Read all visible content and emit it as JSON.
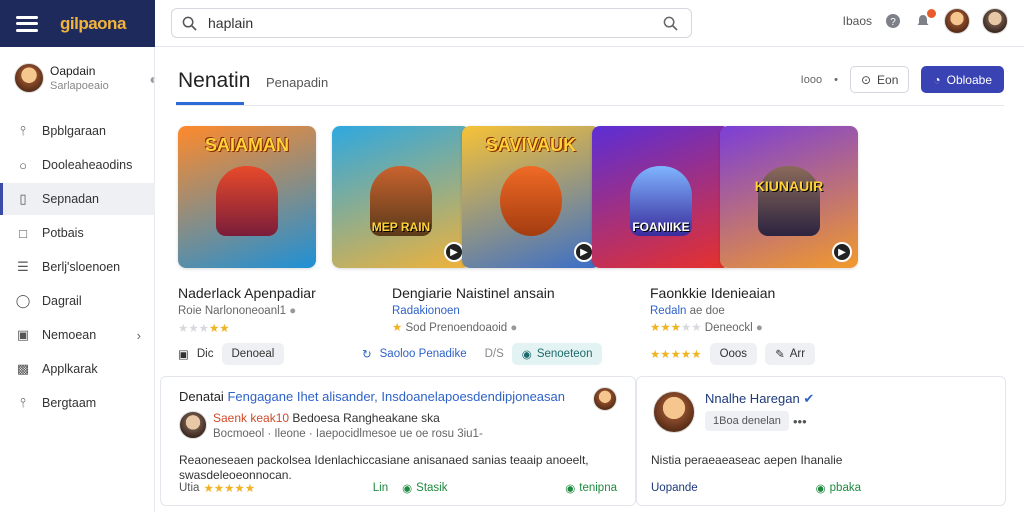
{
  "brand": {
    "logo": "gilpaona"
  },
  "search": {
    "value": "haplain"
  },
  "topbar": {
    "link": "Ibaos"
  },
  "profile": {
    "name": "Oapdain",
    "subtitle": "Sarlapoeaio"
  },
  "sidebar": {
    "items": [
      {
        "label": "Bpblgaraan",
        "icon": "pin-icon"
      },
      {
        "label": "Dooleaheaodins",
        "icon": "shield-icon"
      },
      {
        "label": "Sepnadan",
        "icon": "document-icon",
        "active": true
      },
      {
        "label": "Potbais",
        "icon": "image-icon"
      },
      {
        "label": "Berlj'sloenoen",
        "icon": "list-icon"
      },
      {
        "label": "Dagrail",
        "icon": "chat-icon"
      },
      {
        "label": "Nemoean",
        "icon": "grid-icon",
        "chevron": true
      },
      {
        "label": "Applkarak",
        "icon": "app-icon"
      },
      {
        "label": "Bergtaam",
        "icon": "person-icon"
      }
    ]
  },
  "main": {
    "title": "Nenatin",
    "tab2": "Penapadin",
    "header_small": "Iooo",
    "btn_outline": "Eon",
    "btn_primary": "Obloabe"
  },
  "tiles": [
    {
      "title": "SAIAMAN",
      "sub": "",
      "colors": [
        "#ff8a2b",
        "#1e90d6"
      ]
    },
    {
      "title": "",
      "sub": "MEP RAIN",
      "colors": [
        "#2ea8e0",
        "#f0b23a"
      ]
    },
    {
      "title": "SAVIVAUK",
      "sub": "",
      "colors": [
        "#f7c236",
        "#3a6ec8"
      ]
    },
    {
      "title": "",
      "sub": "FOANIIKE",
      "colors": [
        "#5b2ed6",
        "#e8312a"
      ]
    },
    {
      "title": "",
      "sub": "KIUNAUIR",
      "colors": [
        "#7b3ed8",
        "#f29a2b"
      ]
    }
  ],
  "cards": [
    {
      "title": "Naderlack Apenpadiar",
      "sub_plain": "Roie Narlononeoanl1",
      "sub_blue": "",
      "rating_text": "",
      "stars": 2,
      "action_label": "Dic",
      "pill": "Denoeal"
    },
    {
      "title": "Dengiarie Naistinel ansain",
      "sub_plain": "",
      "sub_blue": "Radakionoen",
      "rating_text": "Sod Prenoendoaoid",
      "stars": 1,
      "action_label": "Saoloo Penadike",
      "pill": "Senoeteon",
      "prefix": "D/S"
    },
    {
      "title": "Faonkkie Idenieaian",
      "sub_plain": "ae doe",
      "sub_blue": "Redaln",
      "rating_text": "Deneockl",
      "stars": 3,
      "action_label": "",
      "pill": "Ooos",
      "pill2": "Arr"
    }
  ],
  "panel1": {
    "heading_plain": "Denatai",
    "heading_blue": "Fengagane Ihet alisander, Insdoanelapoesdendipjoneasan",
    "row1_red": "Saenk keak10",
    "row1_plain": "Bedoesa Rangheakane ska",
    "row2": "Bocmoeol · Ileone · Iaepocidlmesoe ue oe rosu 3iu1-",
    "body": "Reaoneseaen packolsea Idenlachiccasiane anisanaed sanias teaaip anoeelt, swasdeleoeonnocan.",
    "foot_left": "Utia",
    "foot_mid": "Lin",
    "foot_status": "Stasik",
    "foot_right": "tenipna"
  },
  "panel2": {
    "name": "Nnalhe Haregan",
    "tag": "1Boa denelan",
    "body": "Nistia peraeaeaseac aepen Ihanalie",
    "foot_left": "Uopande",
    "foot_right": "pbaka"
  }
}
